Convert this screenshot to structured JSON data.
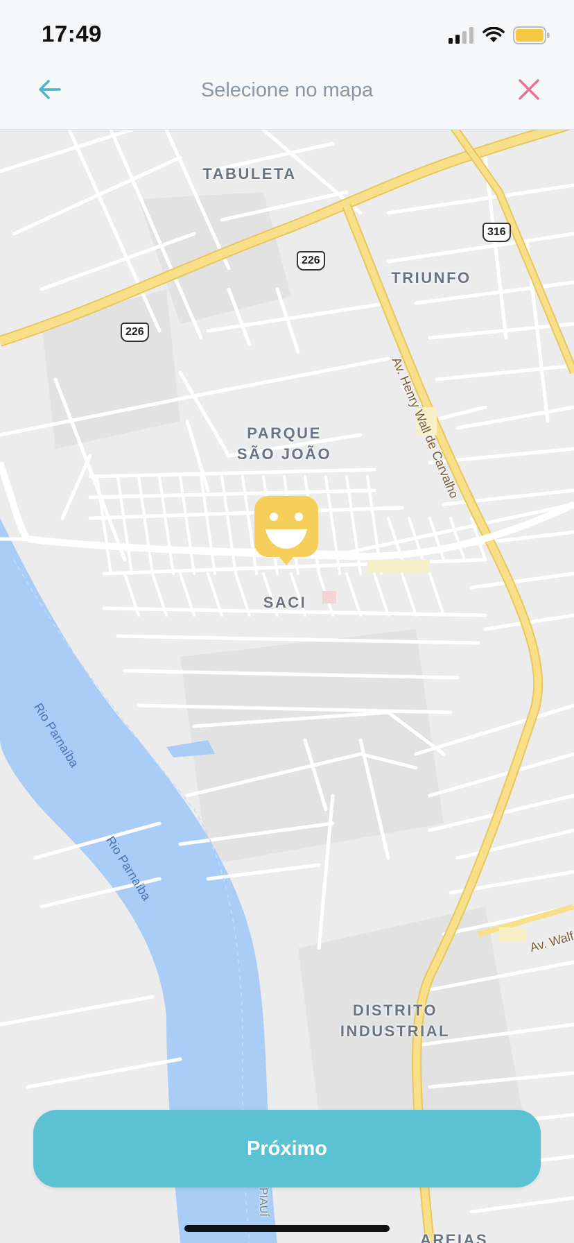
{
  "status_bar": {
    "time": "17:49"
  },
  "nav": {
    "title": "Selecione no mapa"
  },
  "map": {
    "neighborhoods": [
      {
        "id": "tabuleta",
        "text": "TABULETA"
      },
      {
        "id": "triunfo",
        "text": "TRIUNFO"
      },
      {
        "id": "parque-sao-joao-1",
        "text": "PARQUE"
      },
      {
        "id": "parque-sao-joao-2",
        "text": "SÃO JOÃO"
      },
      {
        "id": "saci",
        "text": "SACI"
      },
      {
        "id": "distrito-1",
        "text": "DISTRITO"
      },
      {
        "id": "distrito-2",
        "text": "INDUSTRIAL"
      },
      {
        "id": "areias",
        "text": "AREIAS"
      }
    ],
    "road_shields": [
      "226",
      "226",
      "316"
    ],
    "road_names": [
      "Av. Henry Wall de Carvalho",
      "Av. Walf",
      "PIAUÍ"
    ],
    "river_names": [
      "Rio Parnaíba",
      "Rio Parnaíba"
    ],
    "colors": {
      "highway": "#f5d66f",
      "water": "#a9cdf7",
      "land": "#ececec",
      "road": "#ffffff",
      "pin": "#f6cf5a",
      "button": "#5bc2d3",
      "close": "#e57396",
      "back": "#4fb3c8"
    }
  },
  "actions": {
    "next_label": "Próximo"
  }
}
